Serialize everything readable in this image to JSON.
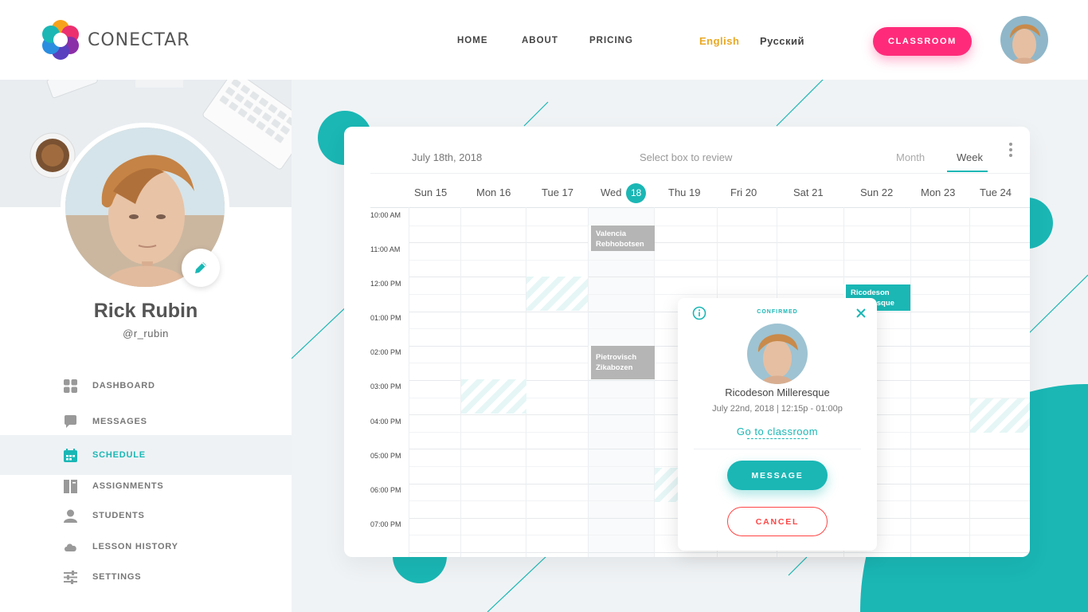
{
  "header": {
    "logo_text": "CONECTAR",
    "nav": [
      {
        "label": "HOME"
      },
      {
        "label": "ABOUT"
      },
      {
        "label": "PRICING"
      }
    ],
    "languages": {
      "english": "English",
      "russian": "Русский",
      "active": "English"
    },
    "classroom_label": "CLASSROOM",
    "colors": {
      "accent_pink": "#ff2b7a",
      "accent_lang": "#e9a824"
    }
  },
  "profile": {
    "name": "Rick Rubin",
    "handle": "@r_rubin"
  },
  "sidebar": {
    "items": [
      {
        "label": "DASHBOARD",
        "icon": "grid-icon",
        "active": false
      },
      {
        "label": "MESSAGES",
        "icon": "chat-bubble-icon",
        "active": false
      },
      {
        "label": "SCHEDULE",
        "icon": "calendar-icon",
        "active": true
      },
      {
        "label": "ASSIGNMENTS",
        "icon": "book-icon",
        "active": false
      },
      {
        "label": "STUDENTS",
        "icon": "user-icon",
        "active": false
      },
      {
        "label": "LESSON HISTORY",
        "icon": "cloud-icon",
        "active": false
      },
      {
        "label": "SETTINGS",
        "icon": "sliders-icon",
        "active": false
      }
    ]
  },
  "calendar": {
    "current_date": "July 18th, 2018",
    "hint": "Select box to review",
    "views": {
      "month": "Month",
      "week": "Week",
      "active": "Week"
    },
    "days": [
      {
        "label": "Sun 15"
      },
      {
        "label": "Mon 16"
      },
      {
        "label": "Tue 17"
      },
      {
        "label": "Wed",
        "badge": "18"
      },
      {
        "label": "Thu 19"
      },
      {
        "label": "Fri 20"
      },
      {
        "label": "Sat 21"
      },
      {
        "label": "Sun 22"
      },
      {
        "label": "Mon 23"
      },
      {
        "label": "Tue 24"
      }
    ],
    "times": [
      "10:00 AM",
      "11:00 AM",
      "12:00 PM",
      "01:00 PM",
      "02:00 PM",
      "03:00 PM",
      "04:00 PM",
      "05:00 PM",
      "06:00 PM",
      "07:00 PM"
    ],
    "events": [
      {
        "line1": "Valencia",
        "line2": "Rebhobotsen",
        "style": "grey"
      },
      {
        "line1": "Pietrovisch",
        "line2": "Zikabozen",
        "style": "grey"
      },
      {
        "line1": "Ricodeson",
        "line2": "Millleresque",
        "style": "teal"
      }
    ],
    "accent": "#1ab7b5"
  },
  "popup": {
    "status": "CONFIRMED",
    "name": "Ricodeson Milleresque",
    "time": "July 22nd, 2018 | 12:15p - 01:00p",
    "link": "Go to classroom",
    "message_label": "MESSAGE",
    "cancel_label": "CANCEL"
  }
}
